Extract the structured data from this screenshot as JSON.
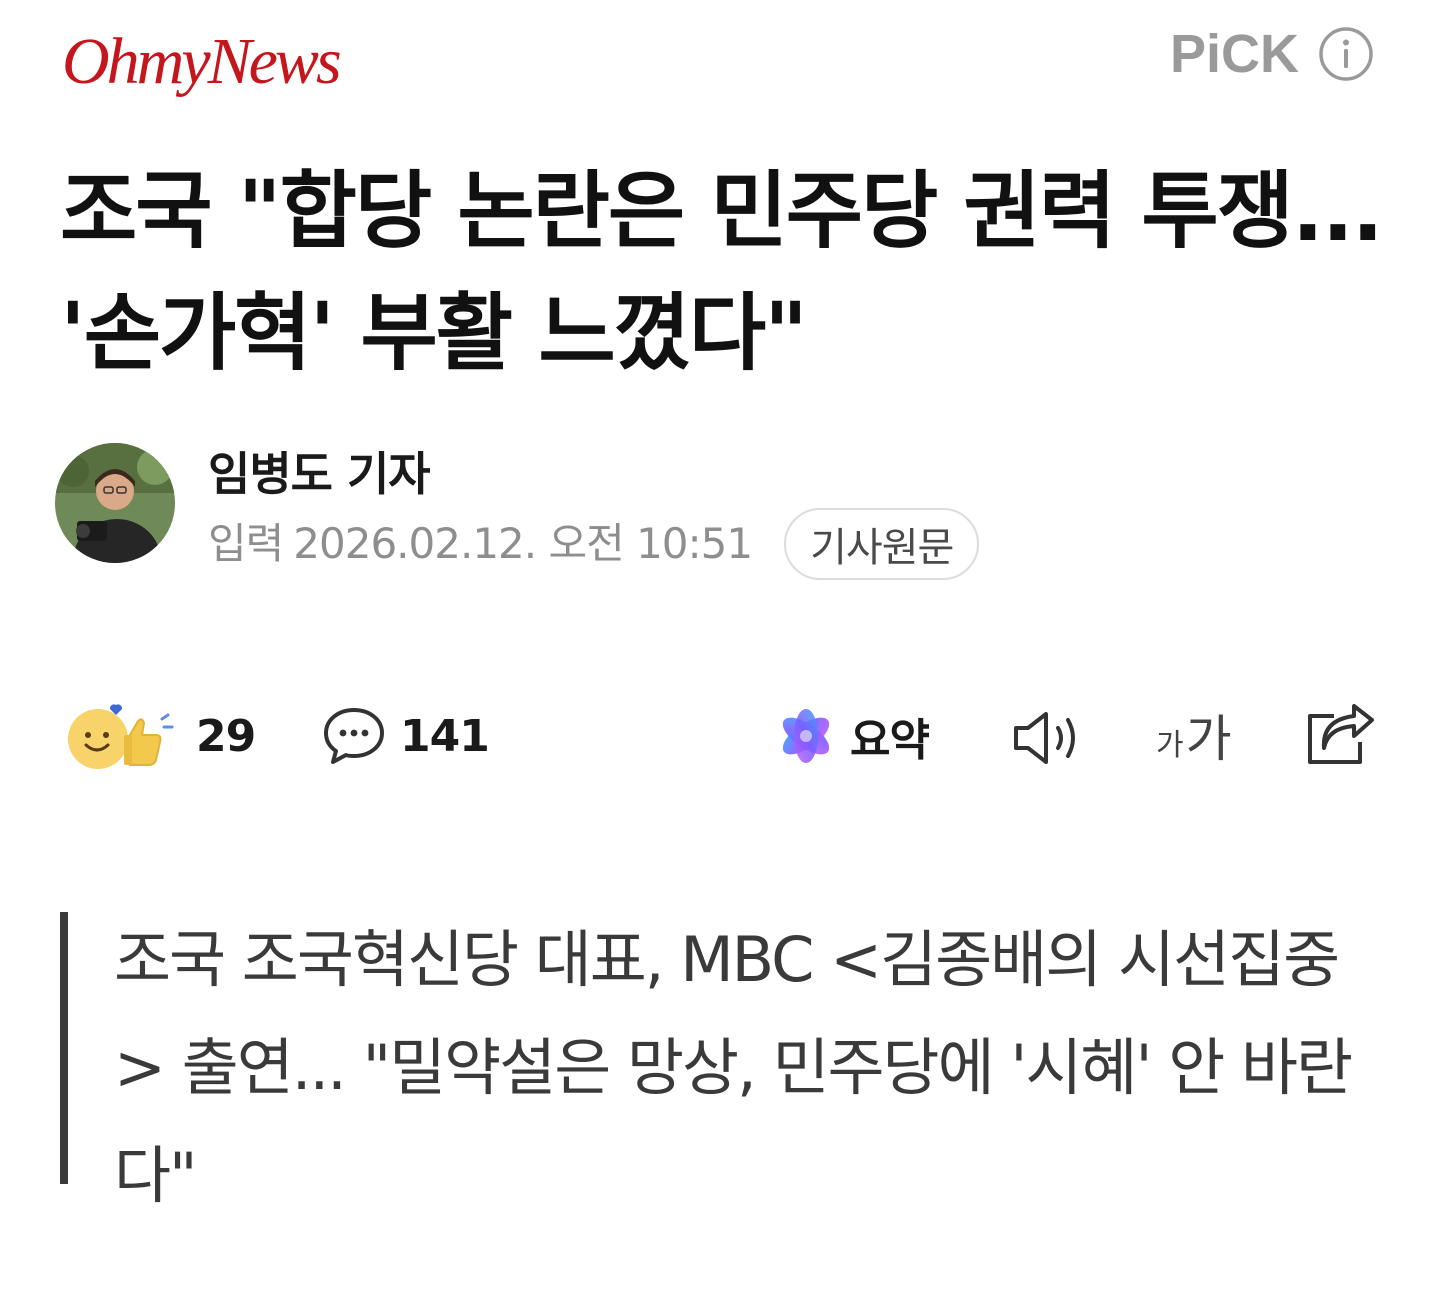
{
  "header": {
    "brand": "OhmyNews",
    "pick_label": "PiCK",
    "info_icon": "info-circle-icon"
  },
  "article": {
    "headline": "조국 \"합당 논란은 민주당 권력 투쟁... '손가혁' 부활 느꼈다\"",
    "author": "임병도 기자",
    "date_label": "입력",
    "date_value": "2026.02.12. 오전 10:51",
    "origin_button": "기사원문"
  },
  "actions": {
    "reaction_icon": "smile-thumbs-up-icon",
    "reaction_count": "29",
    "comment_icon": "speech-bubble-icon",
    "comment_count": "141",
    "summary_icon": "sparkle-icon",
    "summary_label": "요약",
    "tts_icon": "speaker-icon",
    "font_small": "가",
    "font_big": "가",
    "share_icon": "share-icon"
  },
  "summary_quote": "조국 조국혁신당 대표, MBC <김종배의 시선집중> 출연... \"밀약설은 망상, 민주당에 '시혜' 안 바란다\"",
  "colors": {
    "brand_red": "#c4161c",
    "pick_gray": "#9a9a9a",
    "meta_gray": "#8e8e8e",
    "quote_text": "#3a3a3a"
  }
}
